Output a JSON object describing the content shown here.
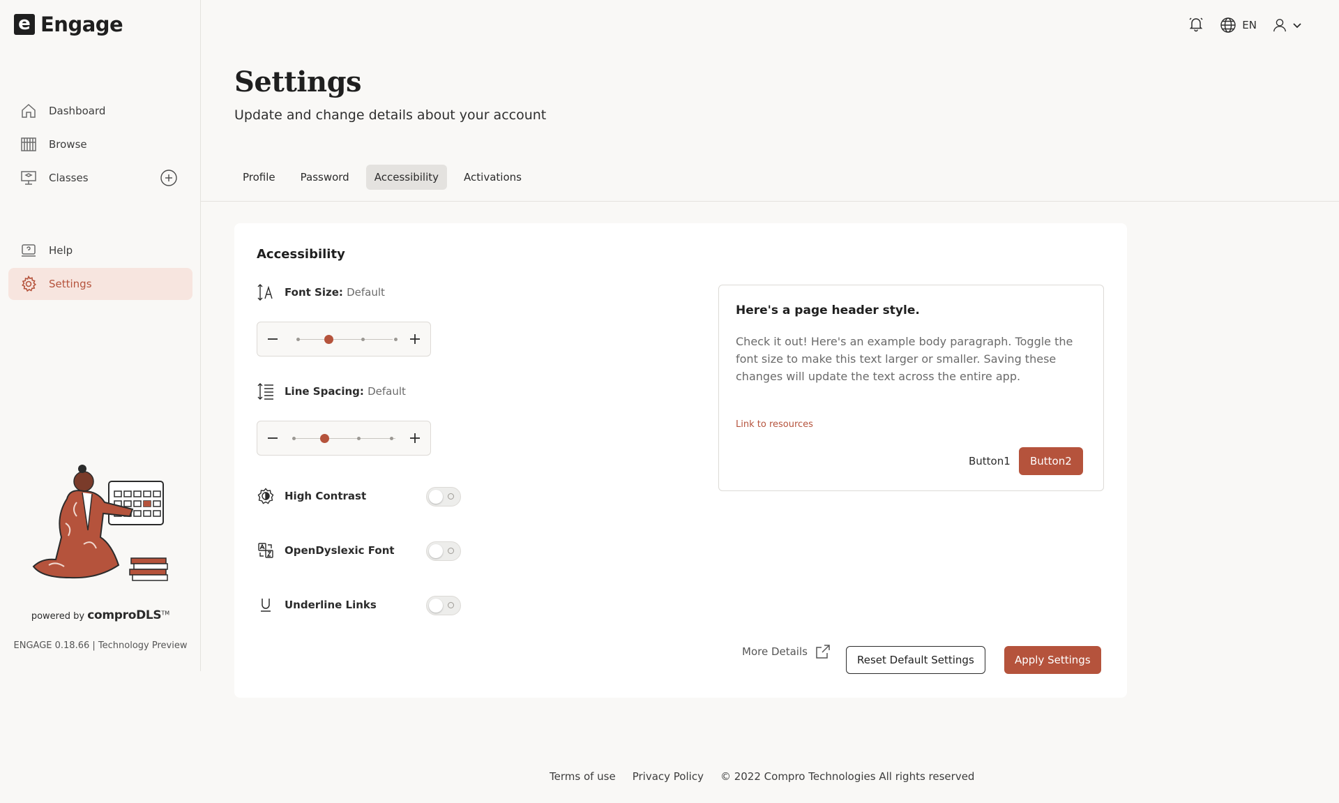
{
  "app": {
    "logo_letter": "e",
    "name": "Engage"
  },
  "nav": {
    "items": [
      {
        "label": "Dashboard",
        "icon": "home-icon"
      },
      {
        "label": "Browse",
        "icon": "library-icon"
      },
      {
        "label": "Classes",
        "icon": "classroom-icon"
      }
    ],
    "secondary": [
      {
        "label": "Help",
        "icon": "help-icon"
      },
      {
        "label": "Settings",
        "icon": "gear-icon",
        "active": true
      }
    ]
  },
  "sidebar_footer": {
    "powered_prefix": "powered by",
    "brand": "comproDLS",
    "trademark": "TM",
    "version": "ENGAGE 0.18.66 | Technology Preview"
  },
  "topbar": {
    "language": "EN"
  },
  "page": {
    "title": "Settings",
    "subtitle": "Update and change details about your account"
  },
  "tabs": [
    {
      "label": "Profile"
    },
    {
      "label": "Password"
    },
    {
      "label": "Accessibility",
      "active": true
    },
    {
      "label": "Activations"
    }
  ],
  "accessibility": {
    "title": "Accessibility",
    "font_size": {
      "label": "Font Size:",
      "value": "Default",
      "level": 2,
      "steps": 4
    },
    "line_spacing": {
      "label": "Line Spacing:",
      "value": "Default",
      "level": 2,
      "steps": 4
    },
    "toggles": [
      {
        "label": "High Contrast",
        "on": false
      },
      {
        "label": "OpenDyslexic Font",
        "on": false
      },
      {
        "label": "Underline Links",
        "on": false
      }
    ],
    "preview": {
      "heading": "Here's a page header style.",
      "body": "Check it out! Here's an example body paragraph. Toggle the font size to make this text larger or smaller. Saving these changes will update the text across the entire app.",
      "link": "Link to resources",
      "button1": "Button1",
      "button2": "Button2"
    },
    "more_details": "More Details",
    "reset_label": "Reset Default Settings",
    "apply_label": "Apply Settings"
  },
  "footer": {
    "terms": "Terms of use",
    "privacy": "Privacy Policy",
    "copyright": "© 2022 Compro Technologies All rights reserved"
  },
  "colors": {
    "accent": "#b5533c",
    "active_bg": "#f7e5df",
    "page_bg": "#f9f8f6"
  }
}
